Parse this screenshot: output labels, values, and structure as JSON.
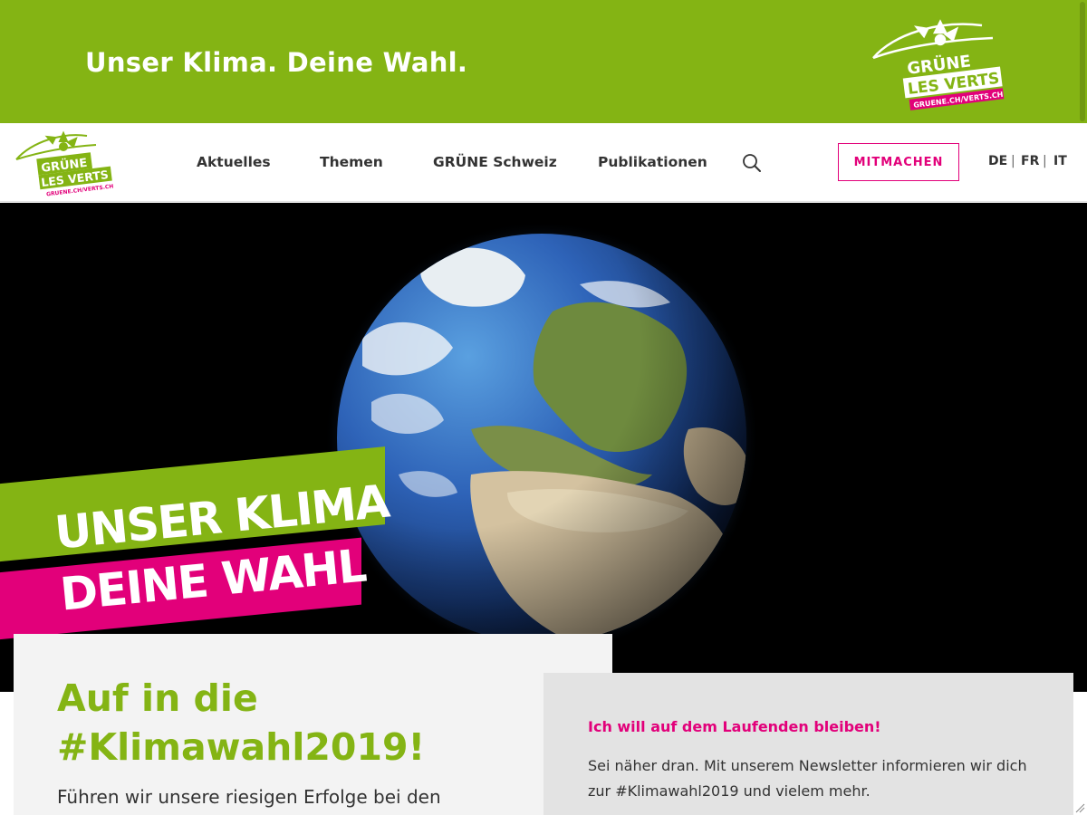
{
  "banner": {
    "slogan": "Unser Klima. Deine Wahl.",
    "logo": {
      "line1": "GRÜNE",
      "line2": "LES VERTS",
      "url": "GRUENE.CH/VERTS.CH"
    }
  },
  "nav": {
    "logo": {
      "line1": "GRÜNE",
      "line2": "LES VERTS",
      "url": "GRUENE.CH/VERTS.CH"
    },
    "items": [
      {
        "label": "Aktuelles"
      },
      {
        "label": "Themen"
      },
      {
        "label": "GRÜNE Schweiz"
      },
      {
        "label": "Publikationen"
      }
    ],
    "search_icon": "search-icon",
    "cta_label": "MITMACHEN",
    "languages": [
      "DE",
      "FR",
      "IT"
    ],
    "lang_separator": "|"
  },
  "hero": {
    "stripe_line1": "UNSER KLIMA",
    "stripe_line2": "DEINE WAHL"
  },
  "intro": {
    "title_line1": "Auf in die",
    "title_line2": "#Klimawahl2019!",
    "text": "Führen wir unsere riesigen Erfolge bei den"
  },
  "newsletter": {
    "title": "Ich will auf dem Laufenden bleiben!",
    "text": "Sei näher dran. Mit unserem Newsletter informieren wir dich zur #Klimawahl2019 und vielem mehr."
  },
  "colors": {
    "green": "#84b414",
    "pink": "#e2007a"
  }
}
